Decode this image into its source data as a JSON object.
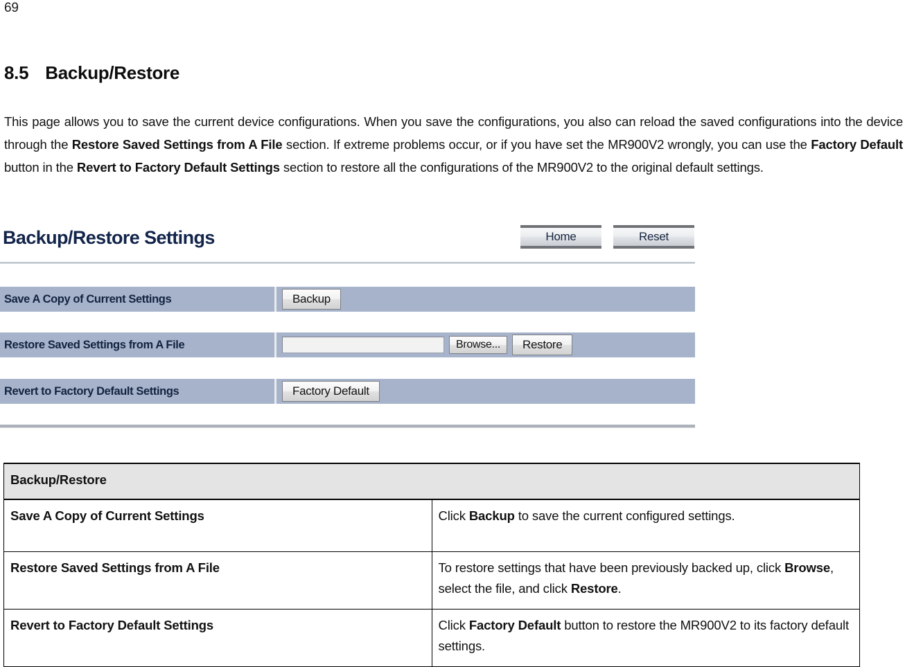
{
  "page": {
    "number": "69"
  },
  "section": {
    "number": "8.5",
    "title": "Backup/Restore",
    "intro_parts": [
      {
        "text": "This page allows you to save the current device configurations. When you save the configurations, you also can reload the saved configurations into the device through the ",
        "bold": false
      },
      {
        "text": "Restore Saved Settings from A File",
        "bold": true
      },
      {
        "text": " section. If extreme problems occur, or if you have set the MR900V2 wrongly, you can use the ",
        "bold": false
      },
      {
        "text": "Factory Default",
        "bold": true
      },
      {
        "text": " button in the ",
        "bold": false
      },
      {
        "text": "Revert to Factory Default Settings",
        "bold": true
      },
      {
        "text": " section to restore all the configurations of the MR900V2 to the original default settings.",
        "bold": false
      }
    ]
  },
  "router_ui": {
    "title": "Backup/Restore Settings",
    "nav_buttons": [
      {
        "label": "Home"
      },
      {
        "label": "Reset"
      }
    ],
    "rows": [
      {
        "label": "Save A Copy of Current Settings",
        "button": "Backup"
      },
      {
        "label": "Restore Saved Settings from A File",
        "file_value": "",
        "file_placeholder": "",
        "browse_button": "Browse...",
        "button": "Restore"
      },
      {
        "label": "Revert to Factory Default Settings",
        "button": "Factory Default"
      }
    ]
  },
  "desc_table": {
    "header": "Backup/Restore",
    "rows": [
      {
        "key": "Save A Copy of Current Settings",
        "value_parts": [
          {
            "text": "Click ",
            "bold": false
          },
          {
            "text": "Backup",
            "bold": true
          },
          {
            "text": " to save the current configured settings.",
            "bold": false
          }
        ]
      },
      {
        "key": "Restore Saved Settings from A File",
        "value_parts": [
          {
            "text": "To restore settings that have been previously backed up, click ",
            "bold": false
          },
          {
            "text": "Browse",
            "bold": true
          },
          {
            "text": ", select the file, and click ",
            "bold": false
          },
          {
            "text": "Restore",
            "bold": true
          },
          {
            "text": ".",
            "bold": false
          }
        ]
      },
      {
        "key": "Revert to Factory Default Settings",
        "value_parts": [
          {
            "text": "Click ",
            "bold": false
          },
          {
            "text": "Factory Default",
            "bold": true
          },
          {
            "text": " button to restore the MR900V2 to its factory default settings.",
            "bold": false
          }
        ]
      }
    ]
  },
  "colors": {
    "row_bar": "#a6b3cb",
    "router_title": "#12244a",
    "table_header_bg": "#e4e4e4"
  }
}
